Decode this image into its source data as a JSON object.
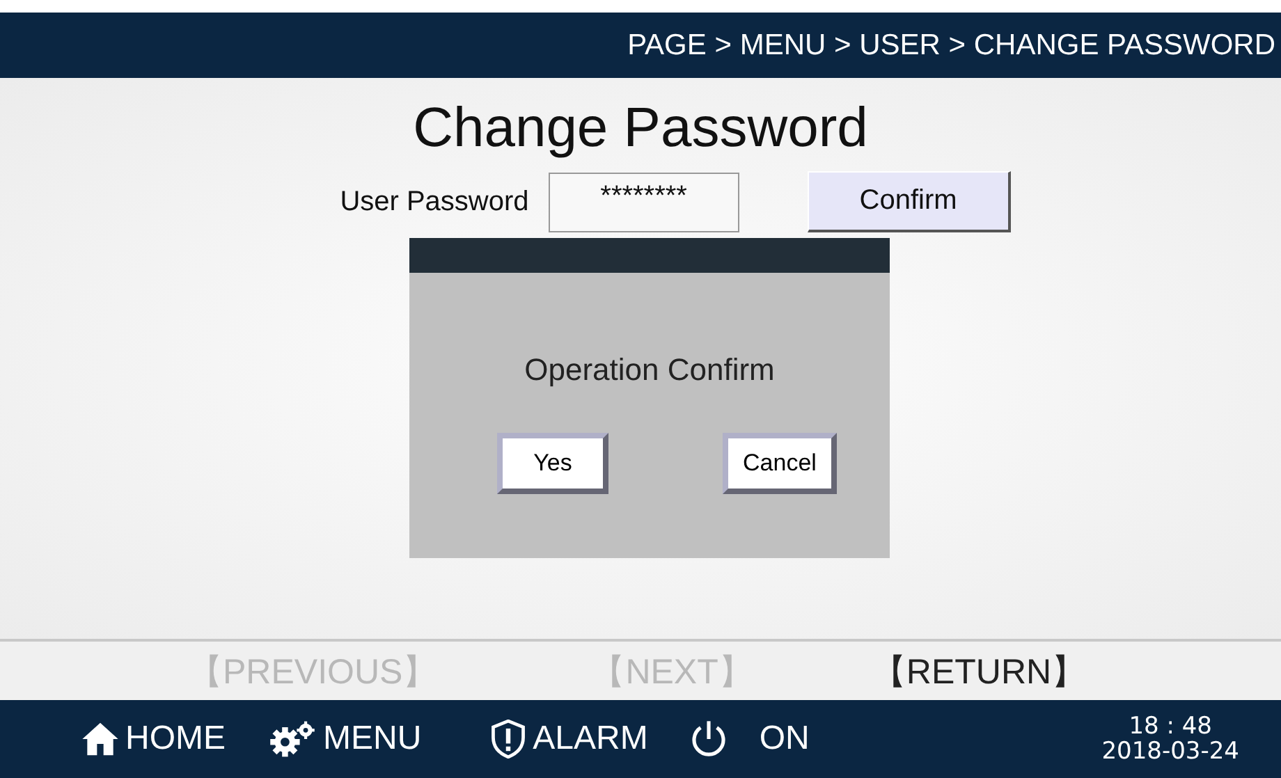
{
  "breadcrumb": "PAGE > MENU > USER > CHANGE PASSWORD",
  "title": "Change Password",
  "password": {
    "label": "User Password",
    "value": "********"
  },
  "confirm_button": "Confirm",
  "dialog": {
    "message": "Operation Confirm",
    "buttons": [
      "Yes",
      "Cancel"
    ]
  },
  "nav": [
    {
      "label": "【PREVIOUS】",
      "disabled": true
    },
    {
      "label": "【NEXT】",
      "disabled": true
    },
    {
      "label": "【RETURN】",
      "disabled": false
    }
  ],
  "taskbar": [
    {
      "kind": "home",
      "label": "HOME"
    },
    {
      "kind": "menu",
      "label": "MENU"
    },
    {
      "kind": "alarm",
      "label": "ALARM"
    },
    {
      "kind": "power",
      "label": "ON"
    }
  ],
  "clock": {
    "time": "18 : 48",
    "date": "2018-03-24"
  }
}
